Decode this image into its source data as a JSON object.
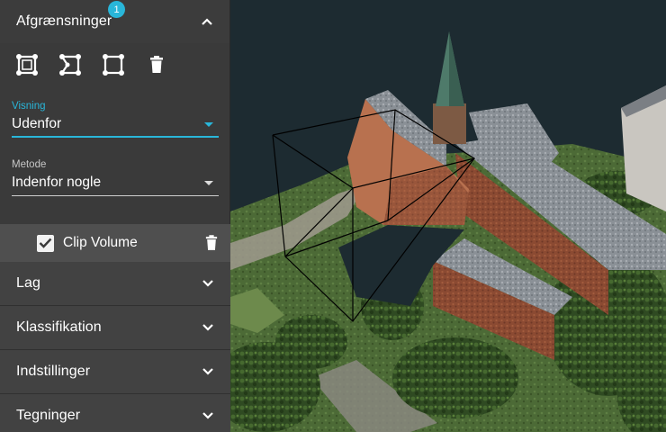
{
  "panel": {
    "boundaries": {
      "title": "Afgrænsninger",
      "badge": "1",
      "tools": [
        {
          "icon": "clip-box-icon"
        },
        {
          "icon": "clip-polygon-icon"
        },
        {
          "icon": "clip-box-outline-icon"
        },
        {
          "icon": "trash-icon"
        }
      ],
      "visning": {
        "label": "Visning",
        "value": "Udenfor"
      },
      "metode": {
        "label": "Metode",
        "value": "Indenfor nogle"
      },
      "clip_volume": {
        "label": "Clip Volume",
        "checked": true
      }
    },
    "sections": [
      {
        "title": "Lag"
      },
      {
        "title": "Klassifikation"
      },
      {
        "title": "Indstillinger"
      },
      {
        "title": "Tegninger"
      }
    ]
  },
  "colors": {
    "accent": "#29b6d9",
    "panel_bg": "#3a3a3a",
    "header_bg": "#424242"
  }
}
